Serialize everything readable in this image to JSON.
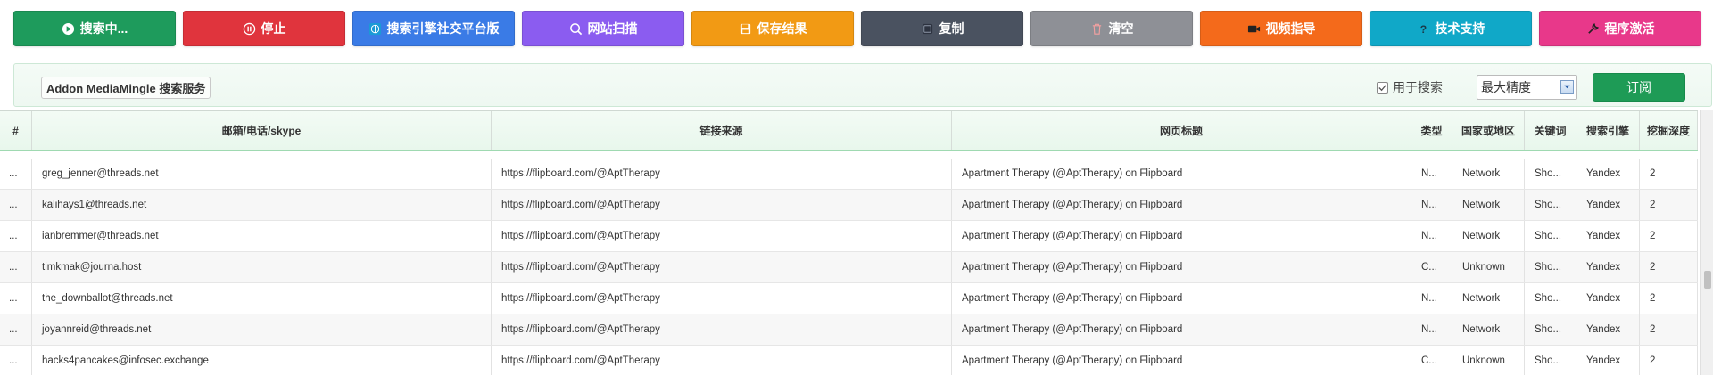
{
  "toolbar": {
    "buttons": [
      {
        "label": "搜索中...",
        "icon": "play-icon",
        "color": "#1e9b5c"
      },
      {
        "label": "停止",
        "icon": "pause-icon",
        "color": "#e0343d"
      },
      {
        "label": "搜索引擎社交平台版",
        "icon": "globe-icon",
        "color": "#3a7be6"
      },
      {
        "label": "网站扫描",
        "icon": "search-icon",
        "color": "#8b5cf0"
      },
      {
        "label": "保存结果",
        "icon": "save-icon",
        "color": "#f29a14"
      },
      {
        "label": "复制",
        "icon": "copy-icon",
        "color": "#4a5260"
      },
      {
        "label": "清空",
        "icon": "trash-icon",
        "color": "#8e9096"
      },
      {
        "label": "视频指导",
        "icon": "video-icon",
        "color": "#f46a1b"
      },
      {
        "label": "技术支持",
        "icon": "help-icon",
        "color": "#10a8c8"
      },
      {
        "label": "程序激活",
        "icon": "wrench-icon",
        "color": "#e8388a"
      }
    ]
  },
  "subbar": {
    "addon_label": "Addon MediaMingle 搜索服务",
    "use_search_label": "用于搜索",
    "use_search_checked": true,
    "precision_value": "最大精度",
    "subscribe_label": "订阅"
  },
  "table": {
    "columns": [
      "#",
      "邮箱/电话/skype",
      "链接来源",
      "网页标题",
      "类型",
      "国家或地区",
      "关键词",
      "搜索引擎",
      "挖掘深度"
    ],
    "rows": [
      [
        "...",
        "greg_jenner@threads.net",
        "https://flipboard.com/@AptTherapy",
        "Apartment Therapy (@AptTherapy) on Flipboard",
        "N...",
        "Network",
        "Sho...",
        "Yandex",
        "2"
      ],
      [
        "...",
        "kalihays1@threads.net",
        "https://flipboard.com/@AptTherapy",
        "Apartment Therapy (@AptTherapy) on Flipboard",
        "N...",
        "Network",
        "Sho...",
        "Yandex",
        "2"
      ],
      [
        "...",
        "ianbremmer@threads.net",
        "https://flipboard.com/@AptTherapy",
        "Apartment Therapy (@AptTherapy) on Flipboard",
        "N...",
        "Network",
        "Sho...",
        "Yandex",
        "2"
      ],
      [
        "...",
        "timkmak@journa.host",
        "https://flipboard.com/@AptTherapy",
        "Apartment Therapy (@AptTherapy) on Flipboard",
        "C...",
        "Unknown",
        "Sho...",
        "Yandex",
        "2"
      ],
      [
        "...",
        "the_downballot@threads.net",
        "https://flipboard.com/@AptTherapy",
        "Apartment Therapy (@AptTherapy) on Flipboard",
        "N...",
        "Network",
        "Sho...",
        "Yandex",
        "2"
      ],
      [
        "...",
        "joyannreid@threads.net",
        "https://flipboard.com/@AptTherapy",
        "Apartment Therapy (@AptTherapy) on Flipboard",
        "N...",
        "Network",
        "Sho...",
        "Yandex",
        "2"
      ],
      [
        "...",
        "hacks4pancakes@infosec.exchange",
        "https://flipboard.com/@AptTherapy",
        "Apartment Therapy (@AptTherapy) on Flipboard",
        "C...",
        "Unknown",
        "Sho...",
        "Yandex",
        "2"
      ]
    ]
  }
}
